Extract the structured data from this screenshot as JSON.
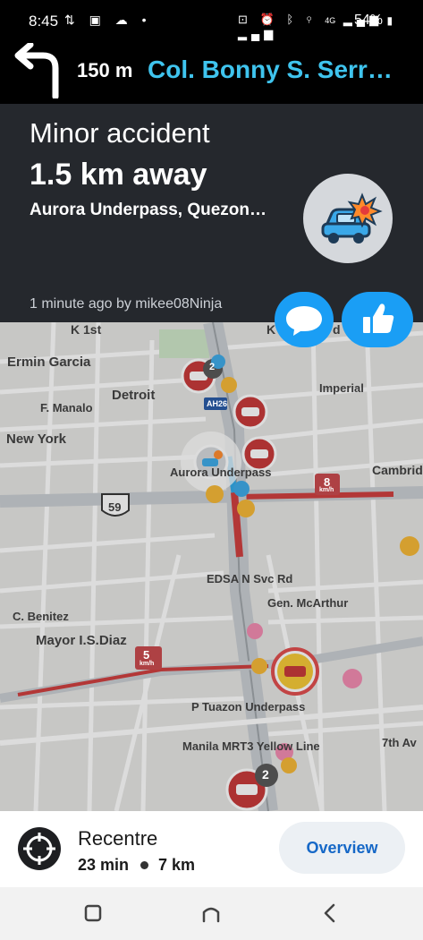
{
  "status_bar": {
    "time": "8:45",
    "left_icons": [
      "notification-icon",
      "image-icon",
      "cloud-icon",
      "dot-icon"
    ],
    "right_icons": [
      "lock-icon",
      "alarm-icon",
      "bluetooth-icon",
      "location-icon",
      "4g-icon",
      "signal-icon",
      "signal-icon"
    ],
    "network": "4G",
    "battery": "54%"
  },
  "navigation": {
    "distance": "150 m",
    "street": "Col. Bonny S. Serr…",
    "turn_icon": "turn-left-arrow-icon"
  },
  "alert": {
    "title": "Minor accident",
    "distance": "1.5 km away",
    "location": "Aurora Underpass, Quezon…",
    "reporter": "1 minute ago by mikee08Ninja",
    "icon": "car-crash-icon",
    "comment_icon": "chat-bubble-icon",
    "thank_icon": "thumbs-up-icon"
  },
  "map": {
    "labels": [
      {
        "id": "k1st",
        "text": "K 1st"
      },
      {
        "id": "k",
        "text": "K"
      },
      {
        "id": "d",
        "text": "d"
      },
      {
        "id": "ermin",
        "text": "Ermin Garcia"
      },
      {
        "id": "detroit",
        "text": "Detroit"
      },
      {
        "id": "imperial",
        "text": "Imperial"
      },
      {
        "id": "fmanalo",
        "text": "F. Manalo"
      },
      {
        "id": "ah26",
        "text": "AH26"
      },
      {
        "id": "newyork",
        "text": "New York"
      },
      {
        "id": "aurora",
        "text": "Aurora Underpass"
      },
      {
        "id": "cambridge",
        "text": "Cambrid"
      },
      {
        "id": "route59",
        "text": "59"
      },
      {
        "id": "speed8",
        "text": "8"
      },
      {
        "id": "speed8unit",
        "text": "km/h"
      },
      {
        "id": "edsa",
        "text": "EDSA N Svc Rd"
      },
      {
        "id": "genmcarthur",
        "text": "Gen. McArthur"
      },
      {
        "id": "cbenitez",
        "text": "C. Benitez"
      },
      {
        "id": "mayor",
        "text": "Mayor I.S.Diaz"
      },
      {
        "id": "speed5",
        "text": "5"
      },
      {
        "id": "speed5unit",
        "text": "km/h"
      },
      {
        "id": "ptuazon",
        "text": "P Tuazon Underpass"
      },
      {
        "id": "mrt3",
        "text": "Manila MRT3 Yellow Line"
      },
      {
        "id": "seventh",
        "text": "7th Av"
      }
    ],
    "badges": [
      {
        "id": "badge2a",
        "text": "2"
      },
      {
        "id": "badge2b",
        "text": "2"
      }
    ],
    "colors": {
      "background": "#e6e6e4",
      "road": "#ffffff",
      "highway": "#c9cdd2",
      "traffic_red": "#cf3b3b",
      "park": "#cde6c7"
    }
  },
  "trip": {
    "recentre_label": "Recentre",
    "time": "23 min",
    "distance": "7 km",
    "overview_label": "Overview",
    "recentre_icon": "recentre-crosshair-icon"
  },
  "android_nav": {
    "recents_icon": "recents-icon",
    "home_icon": "home-icon",
    "back_icon": "back-icon"
  },
  "colors": {
    "accent_blue": "#1a9ef5",
    "street_blue": "#3fc4ee",
    "panel_dark": "#25282d",
    "overview_text": "#1668c7"
  }
}
